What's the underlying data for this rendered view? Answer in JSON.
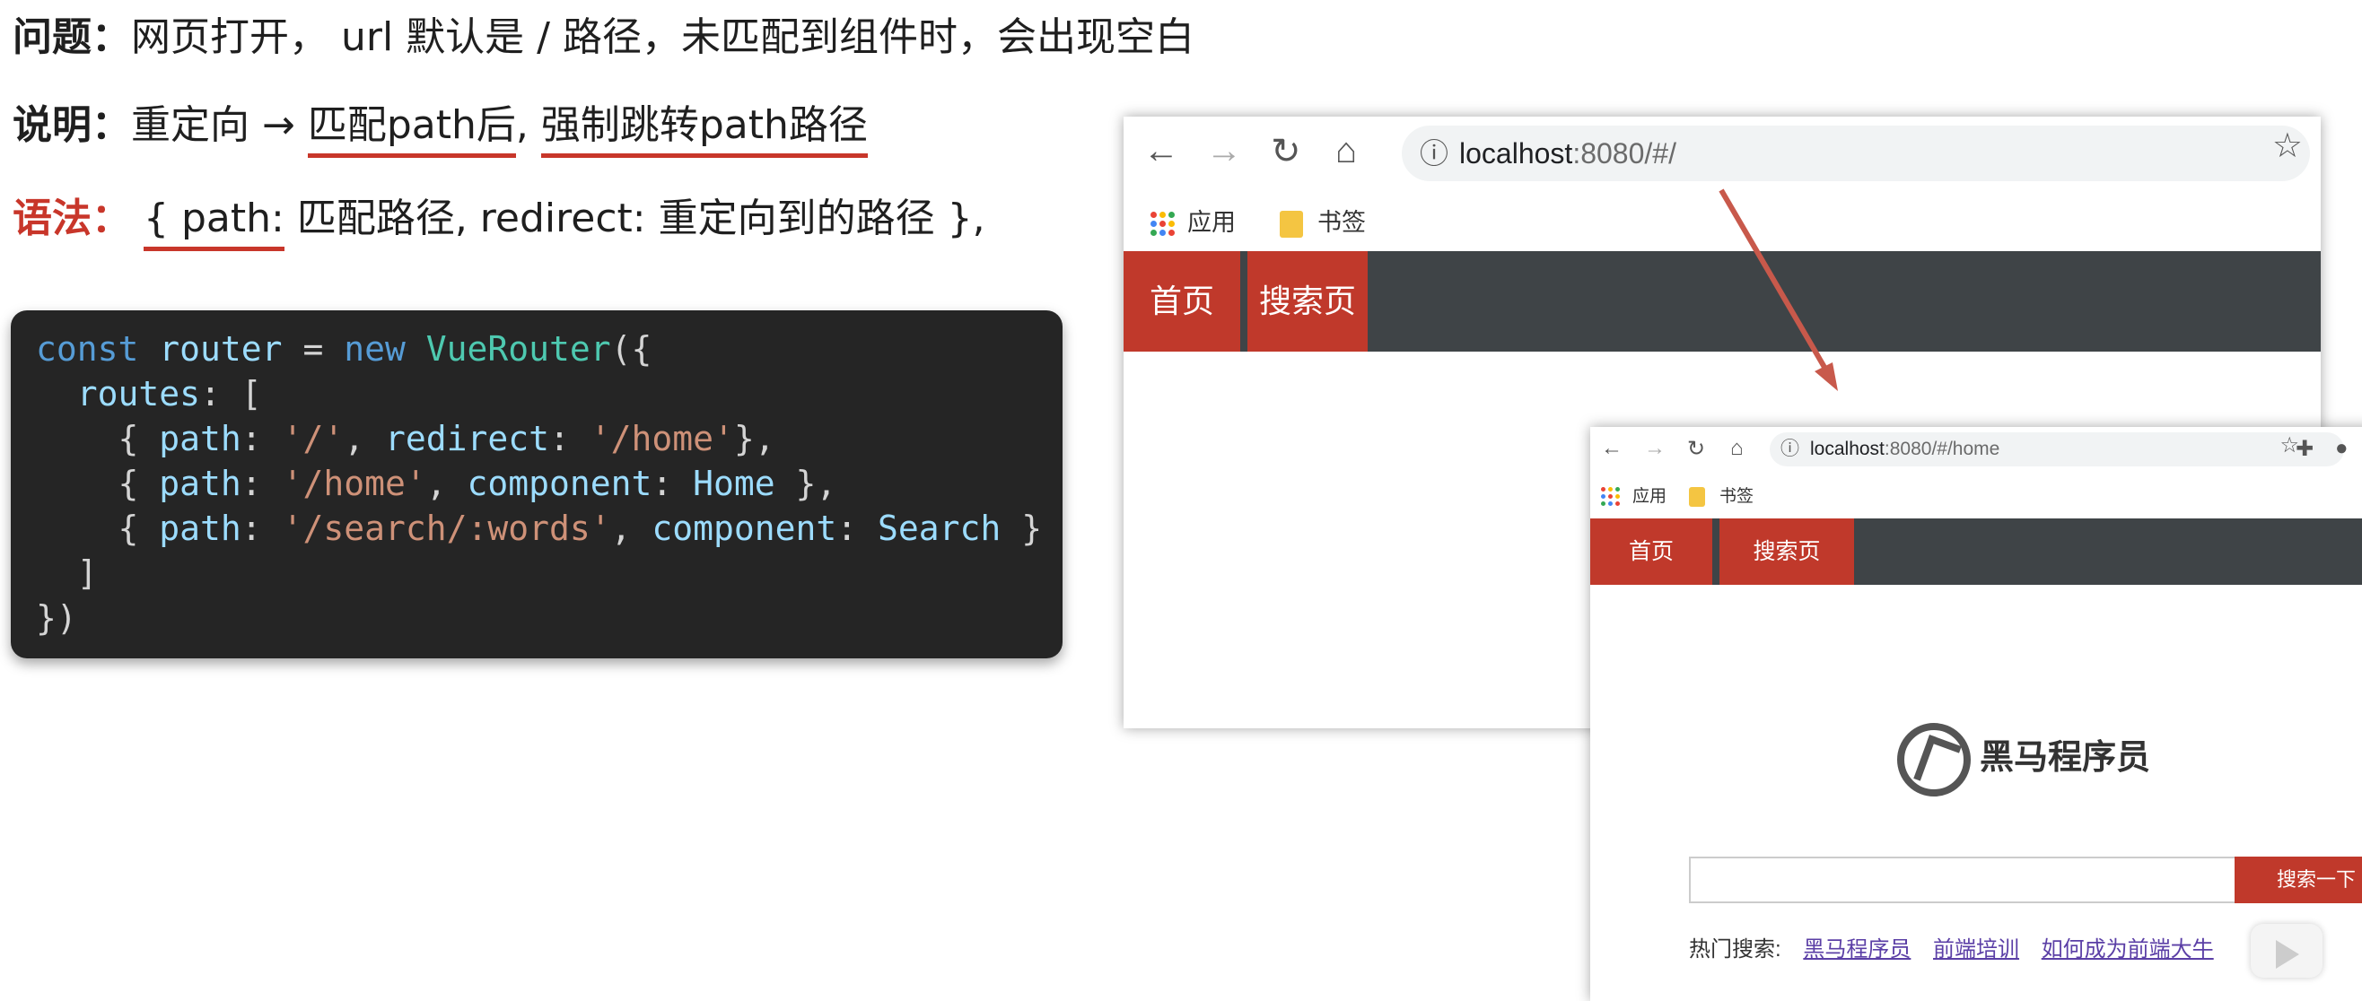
{
  "slide": {
    "problem_label": "问题：",
    "problem_text": "网页打开， url 默认是 / 路径，未匹配到组件时，会出现空白",
    "explain_label": "说明：",
    "explain_prefix": "重定向 → ",
    "explain_part1": "匹配path后",
    "explain_sep": ", ",
    "explain_part2": "强制跳转path路径",
    "syntax_label": "语法：",
    "syntax_part1": "{ path:",
    "syntax_rest": " 匹配路径, redirect: 重定向到的路径 },"
  },
  "code": {
    "t_const": "const",
    "t_router": "router",
    "t_eq": " = ",
    "t_new": "new",
    "t_VueRouter": "VueRouter",
    "t_open": "({",
    "routes_key": "routes",
    "routes_open": ": [",
    "r1_open": "{ ",
    "k_path": "path",
    "colon": ": ",
    "s_root": "'/'",
    "comma": ", ",
    "k_redirect": "redirect",
    "s_home": "'/home'",
    "r1_close": "},",
    "k_component": "component",
    "c_home": "Home",
    "r2_close": " },",
    "s_search": "'/search/:words'",
    "c_search": "Search",
    "r3_close": " }",
    "routes_close": "]",
    "end": "})"
  },
  "browser1": {
    "back_icon": "←",
    "forward_icon": "→",
    "reload_icon": "↻",
    "home_icon": "⌂",
    "info_icon": "ⓘ",
    "url_host": "localhost",
    "url_path": ":8080/#/",
    "star_icon": "☆",
    "apps_label": "应用",
    "bookmarks_label": "书签",
    "nav_home": "首页",
    "nav_search": "搜索页"
  },
  "browser2": {
    "back_icon": "←",
    "forward_icon": "→",
    "reload_icon": "↻",
    "home_icon": "⌂",
    "info_icon": "ⓘ",
    "url_host": "localhost",
    "url_path": ":8080/#/home",
    "star_icon": "☆",
    "ext_icon": "✚",
    "profile_icon": "●",
    "apps_label": "应用",
    "bookmarks_label": "书签",
    "nav_home": "首页",
    "nav_search": "搜索页",
    "logo_text": "黑马程序员",
    "search_button": "搜索一下",
    "search_value": "",
    "hot_label": "热门搜索:",
    "hot_links": [
      "黑马程序员",
      "前端培训",
      "如何成为前端大牛"
    ]
  },
  "colors": {
    "accent_red": "#c0392b",
    "navbar_bg": "#3f4447",
    "code_bg": "#252525",
    "arrow": "#c8594b"
  }
}
